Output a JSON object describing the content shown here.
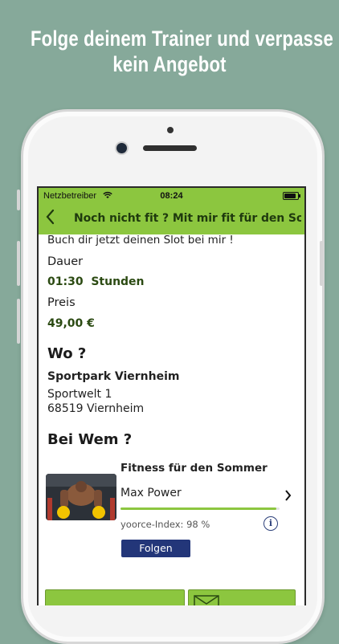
{
  "headline": {
    "line1": "Folge deinem Trainer und verpasse",
    "line2": "kein Angebot"
  },
  "status_bar": {
    "carrier": "Netzbetreiber",
    "time": "08:24"
  },
  "nav": {
    "title": "Noch nicht fit ? Mit mir fit für den Som..."
  },
  "offer": {
    "intro": "Buch dir jetzt deinen Slot bei mir !",
    "duration_label": "Dauer",
    "duration_value": "01:30",
    "duration_unit": "Stunden",
    "price_label": "Preis",
    "price_value": "49,00 €"
  },
  "location": {
    "heading": "Wo ?",
    "venue": "Sportpark Viernheim",
    "street": "Sportwelt 1",
    "zip": "68519",
    "city": "Viernheim"
  },
  "trainer": {
    "heading": "Bei Wem ?",
    "program": "Fitness für den Sommer",
    "first_name": "Max",
    "last_name": "Power",
    "index_label": "yoorce-Index: 98 %",
    "index_value": 0.98,
    "follow_label": "Folgen"
  },
  "colors": {
    "accent": "#8cc63f",
    "button": "#233679",
    "background": "#86a99a"
  }
}
